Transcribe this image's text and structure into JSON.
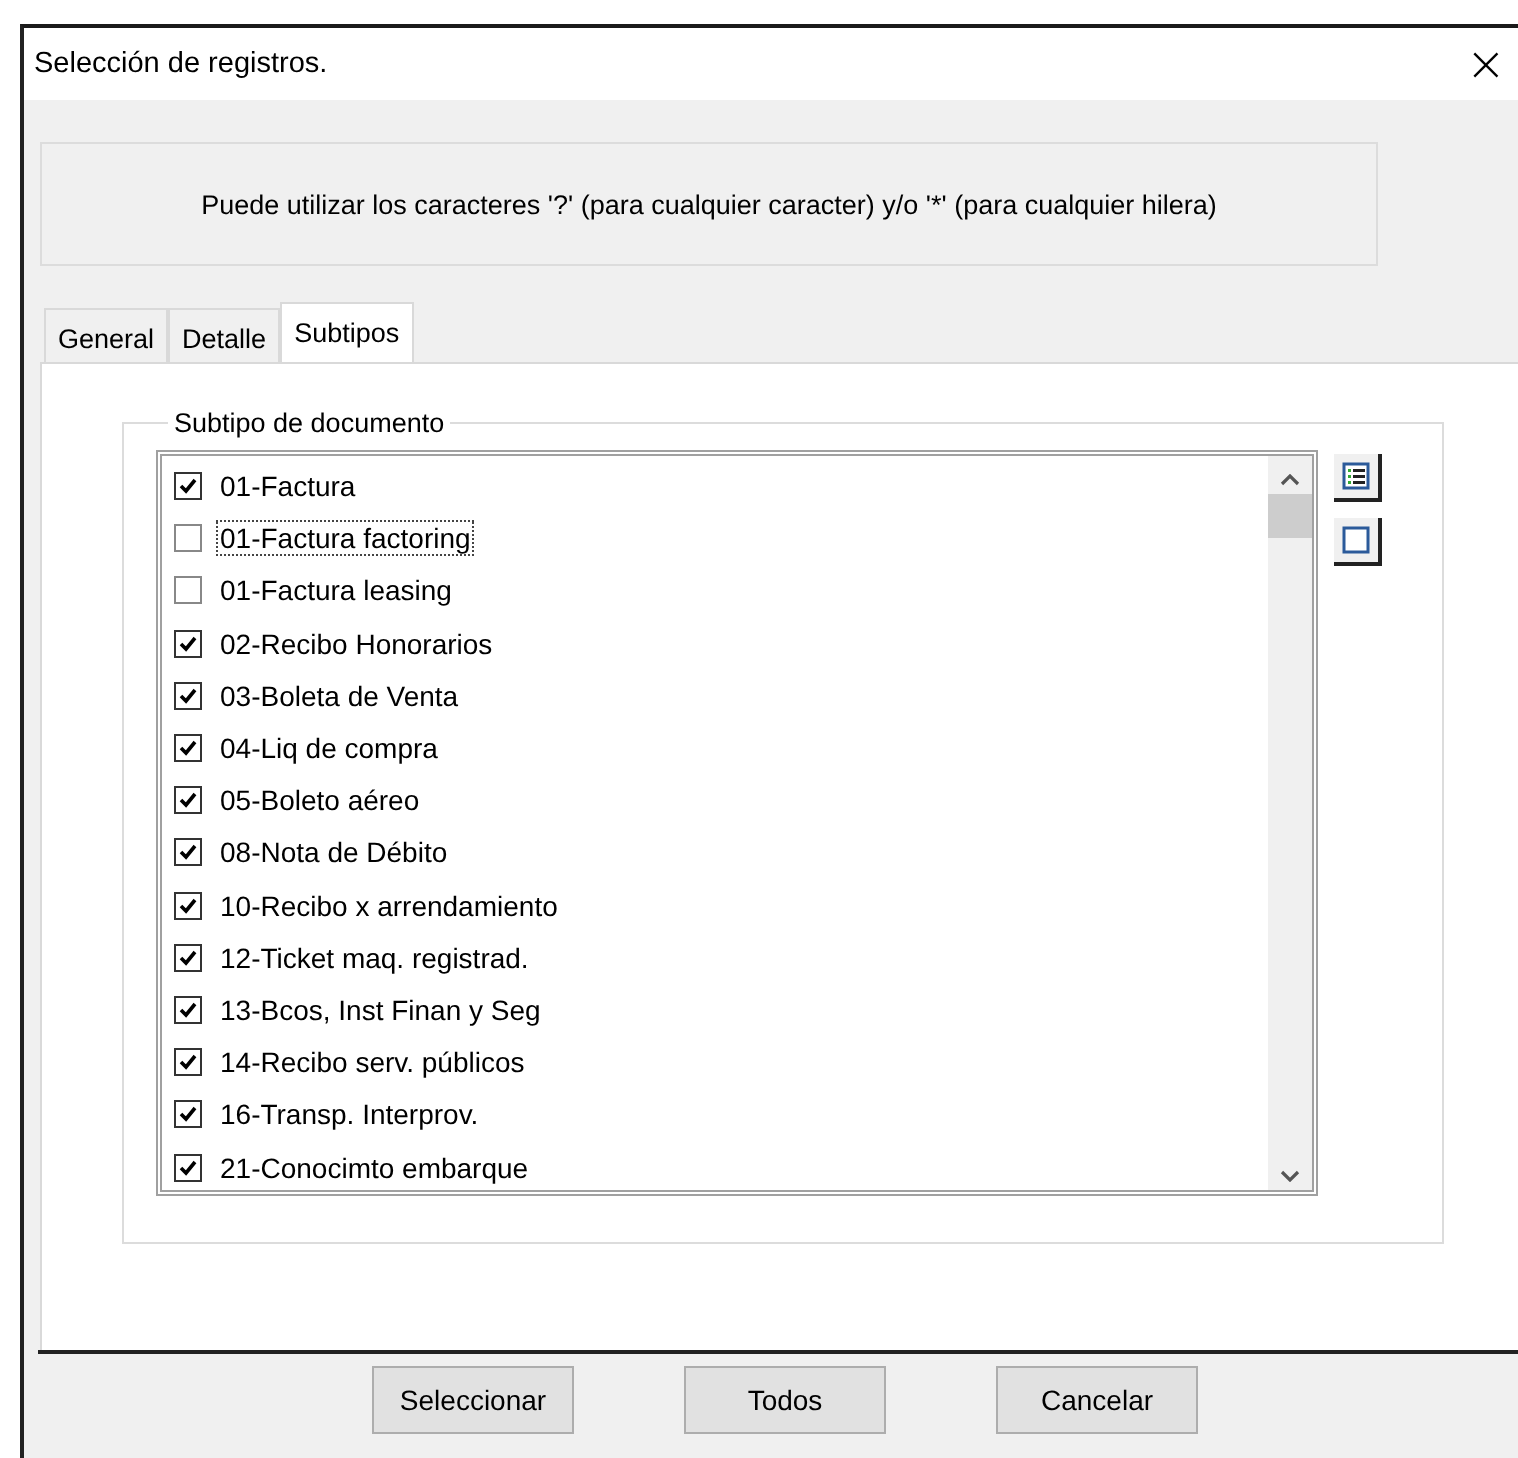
{
  "window": {
    "title": "Selección de registros.",
    "close": "×"
  },
  "info": "Puede utilizar los caracteres '?' (para cualquier caracter) y/o '*' (para cualquier hilera)",
  "tabs": [
    {
      "label": "General",
      "selected": false
    },
    {
      "label": "Detalle",
      "selected": false
    },
    {
      "label": "Subtipos",
      "selected": true
    }
  ],
  "group": {
    "title": "Subtipo de documento",
    "items": [
      {
        "label": "01-Factura",
        "checked": true,
        "focused": false
      },
      {
        "label": "01-Factura factoring",
        "checked": false,
        "focused": true
      },
      {
        "label": "01-Factura leasing",
        "checked": false,
        "focused": false
      },
      {
        "label": "02-Recibo Honorarios",
        "checked": true,
        "focused": false
      },
      {
        "label": "03-Boleta de Venta",
        "checked": true,
        "focused": false
      },
      {
        "label": "04-Liq de compra",
        "checked": true,
        "focused": false
      },
      {
        "label": "05-Boleto aéreo",
        "checked": true,
        "focused": false
      },
      {
        "label": "08-Nota de Débito",
        "checked": true,
        "focused": false
      },
      {
        "label": "10-Recibo x arrendamiento",
        "checked": true,
        "focused": false
      },
      {
        "label": "12-Ticket maq. registrad.",
        "checked": true,
        "focused": false
      },
      {
        "label": "13-Bcos, Inst Finan y Seg",
        "checked": true,
        "focused": false
      },
      {
        "label": "14-Recibo serv. públicos",
        "checked": true,
        "focused": false
      },
      {
        "label": "16-Transp. Interprov.",
        "checked": true,
        "focused": false
      },
      {
        "label": "21-Conocimto embarque",
        "checked": true,
        "focused": false
      }
    ]
  },
  "buttons": [
    "Seleccionar",
    "Todos",
    "Cancelar"
  ]
}
